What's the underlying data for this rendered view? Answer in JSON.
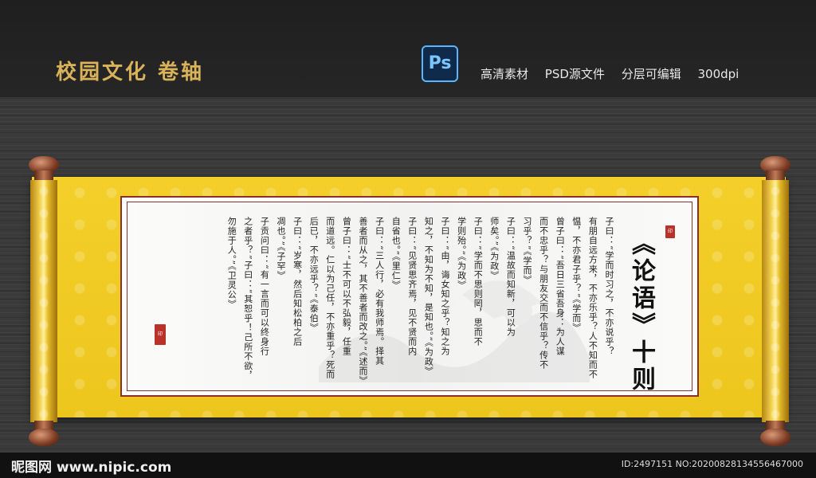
{
  "header": {
    "title": "校园文化 卷轴",
    "ps_logo": "Ps",
    "tags": [
      "高清素材",
      "PSD源文件",
      "分层可编辑",
      "300dpi"
    ]
  },
  "scroll": {
    "heading": "《论语》十则",
    "columns": [
      "子曰：“学而时习之，不亦说乎？",
      "有朋自远方来，不亦乐乎？人不知而不",
      "愠，不亦君子乎？”《学而》",
      "曾子曰：“吾日三省吾身：为人谋",
      "而不忠乎？与朋友交而不信乎？传不",
      "习乎？”《学而》",
      "子曰：“温故而知新，可以为",
      "师矣。”《为政》",
      "子曰：“学而不思则罔，思而不",
      "学则殆。”《为政》",
      "子曰：“由，诲女知之乎？知之为",
      "知之，不知为不知，是知也。”《为政》",
      "子曰：“见贤思齐焉，见不贤而内",
      "自省也。”《里仁》",
      "子曰：“三人行，必有我师焉。择其",
      "善者而从之，其不善者而改之。”《述而》",
      "曾子曰：“士不可以不弘毅，任重",
      "而道远。仁以为己任，不亦重乎？死而",
      "后已，不亦远乎？”《泰伯》",
      "子曰：“岁寒，然后知松柏之后",
      "凋也。”《子罕》",
      "子贡问曰：“有一言而可以终身行",
      "之者乎？”子曰：“其恕乎！己所不欲，",
      "勿施于人。”《卫灵公》"
    ],
    "seal_top": "印",
    "seal_bottom": "印"
  },
  "footer": {
    "site": "昵图网 www.nipic.com",
    "id_text": "ID:2497151 NO:20200828134556467000"
  },
  "colors": {
    "title_gold": "#d9b25a",
    "scroll_yellow": "#f2cc25",
    "frame_red": "#8a2f2a"
  }
}
